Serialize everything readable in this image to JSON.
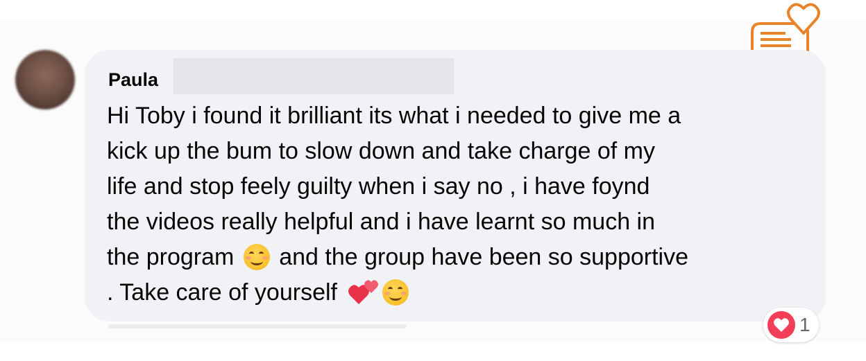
{
  "comment": {
    "author": "Paula",
    "text_lines": [
      "Hi Toby i found it brilliant its what i needed to give me a",
      "kick up the bum to slow down and take charge of my",
      "life and stop feely guilty when i say no , i have foynd",
      "the videos really helpful and i have learnt so much in",
      "the program",
      "and the group have been so supportive",
      ". Take care of yourself"
    ]
  },
  "reactions": {
    "type": "love",
    "count": "1"
  },
  "icons": {
    "logo": "chat-heart-logo-icon",
    "emoji_smile": "smiling-face-emoji-icon",
    "emoji_hearts": "two-hearts-emoji-icon",
    "reaction": "love-reaction-icon"
  },
  "colors": {
    "bubble": "#f0f2f5",
    "logo_orange": "#e8842a",
    "love_red": "#f33e58"
  }
}
